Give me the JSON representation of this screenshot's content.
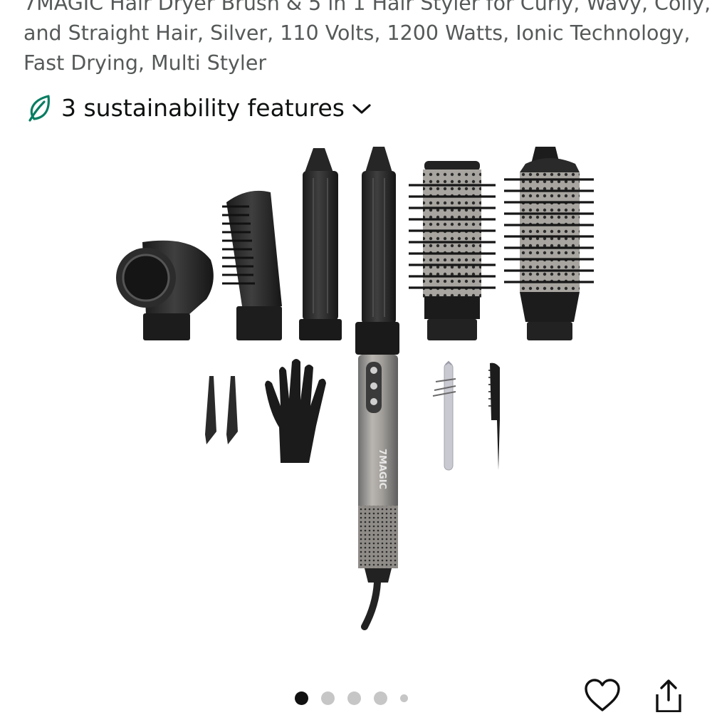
{
  "product": {
    "title_lines": [
      "7MAGIC Hair Dryer Brush & 5 in 1 Hair Styler for Curly, Wavy, Coily,",
      "and Straight Hair, Silver, 110 Volts, 1200 Watts, Ionic Technology,",
      "Fast Drying, Multi Styler"
    ]
  },
  "sustainability": {
    "label": "3 sustainability features",
    "icon": "leaf-icon",
    "expand_icon": "chevron-down-icon",
    "color": "#067D62"
  },
  "gallery": {
    "image_description": "Hair dryer brush set with attachments",
    "handle_brand": "7MAGIC",
    "page_count": 5,
    "active_index": 0
  },
  "actions": {
    "wishlist_icon": "heart-icon",
    "share_icon": "share-icon"
  }
}
